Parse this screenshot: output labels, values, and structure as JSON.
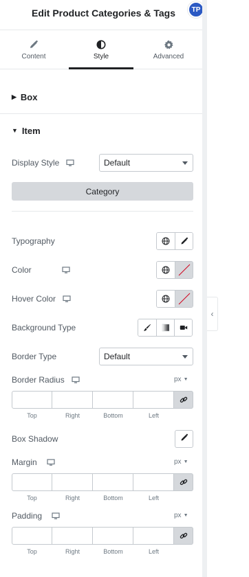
{
  "header": {
    "title": "Edit Product Categories & Tags",
    "avatar_initials": "TP"
  },
  "tabs": [
    {
      "label": "Content",
      "icon": "pencil-icon"
    },
    {
      "label": "Style",
      "icon": "half-circle-icon",
      "active": true
    },
    {
      "label": "Advanced",
      "icon": "gear-icon"
    }
  ],
  "sections": {
    "box": {
      "label": "Box",
      "state": "collapsed"
    },
    "item": {
      "label": "Item",
      "state": "expanded"
    }
  },
  "controls": {
    "display_style": {
      "label": "Display Style",
      "value": "Default"
    },
    "category_button": "Category",
    "typography": {
      "label": "Typography"
    },
    "color": {
      "label": "Color"
    },
    "hover_color": {
      "label": "Hover Color"
    },
    "background_type": {
      "label": "Background Type"
    },
    "border_type": {
      "label": "Border Type",
      "value": "Default"
    },
    "border_radius": {
      "label": "Border Radius",
      "unit": "px"
    },
    "box_shadow": {
      "label": "Box Shadow"
    },
    "margin": {
      "label": "Margin",
      "unit": "px"
    },
    "padding": {
      "label": "Padding",
      "unit": "px"
    }
  },
  "dimension_labels": {
    "top": "Top",
    "right": "Right",
    "bottom": "Bottom",
    "left": "Left"
  },
  "colors": {
    "accent": "#2b59c3",
    "text": "#1f2124",
    "muted": "#515962",
    "border": "#c4c9ce",
    "button_bg": "#d5d8dc",
    "slash": "#d0021b"
  }
}
